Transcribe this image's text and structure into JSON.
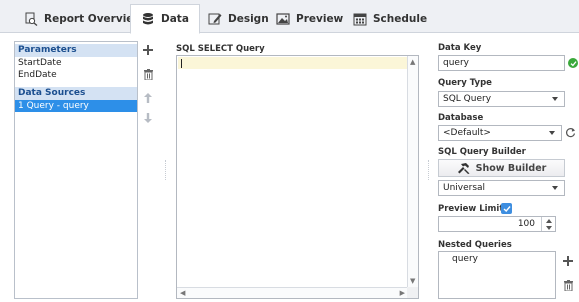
{
  "tabs": [
    {
      "label": "Report Overview",
      "icon": "magnifier-page-icon",
      "active": false
    },
    {
      "label": "Data",
      "icon": "database-icon",
      "active": true
    },
    {
      "label": "Design",
      "icon": "edit-icon",
      "active": false
    },
    {
      "label": "Preview",
      "icon": "image-icon",
      "active": false
    },
    {
      "label": "Schedule",
      "icon": "calendar-icon",
      "active": false
    }
  ],
  "left": {
    "parameters_header": "Parameters",
    "parameters": [
      "StartDate",
      "EndDate"
    ],
    "datasources_header": "Data Sources",
    "datasources": [
      "1 Query - query"
    ]
  },
  "center": {
    "label": "SQL SELECT Query",
    "query_text": ""
  },
  "right": {
    "data_key_label": "Data Key",
    "data_key_value": "query",
    "query_type_label": "Query Type",
    "query_type_value": "SQL Query",
    "database_label": "Database",
    "database_value": "<Default>",
    "builder_label": "SQL Query Builder",
    "builder_button": "Show Builder",
    "builder_dialect": "Universal",
    "preview_limit_label": "Preview Limit",
    "preview_limit_checked": true,
    "preview_limit_value": "100",
    "nested_label": "Nested Queries",
    "nested_items": [
      "query"
    ]
  },
  "colors": {
    "accent": "#2d8fe8",
    "section_header_bg": "#d4e2f3",
    "section_header_text": "#1c4f8f",
    "valid_green": "#3aa83a",
    "editor_highlight": "#fbf6d8"
  }
}
